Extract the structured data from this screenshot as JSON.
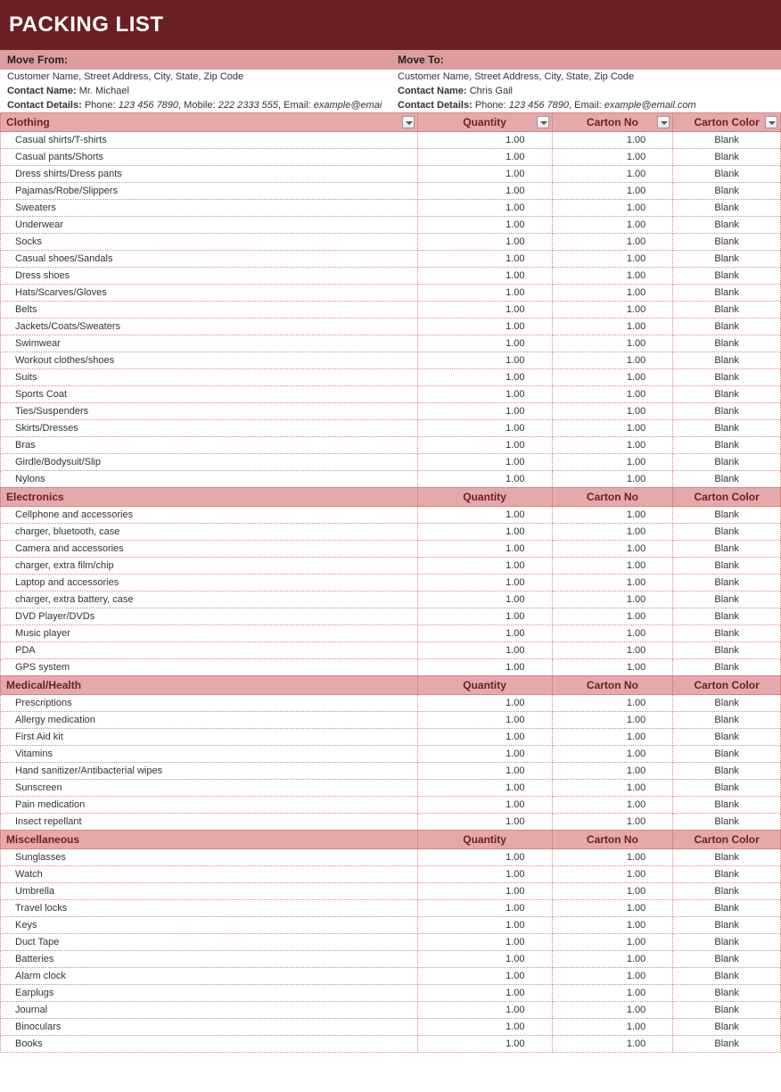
{
  "title": "PACKING LIST",
  "moveFrom": {
    "label": "Move From:",
    "address": "Customer Name, Street Address, City, State, Zip Code",
    "contactNameLabel": "Contact Name:",
    "contactName": "Mr. Michael",
    "contactDetailsLabel": "Contact Details:",
    "phoneLabel": "Phone:",
    "phone": "123 456 7890",
    "mobileLabel": "Mobile:",
    "mobile": "222 2333 555",
    "emailLabel": "Email:",
    "email": "example@emai"
  },
  "moveTo": {
    "label": "Move To:",
    "address": "Customer Name, Street Address, City, State, Zip Code",
    "contactNameLabel": "Contact Name:",
    "contactName": "Chris Gail",
    "contactDetailsLabel": "Contact Details:",
    "phoneLabel": "Phone:",
    "phone": "123 456 7890",
    "emailLabel": "Email:",
    "email": "example@email.com"
  },
  "columns": {
    "qty": "Quantity",
    "carton": "Carton No",
    "color": "Carton Color"
  },
  "sections": [
    {
      "name": "Clothing",
      "showFilters": true,
      "items": [
        {
          "name": "Casual shirts/T-shirts",
          "qty": "1.00",
          "carton": "1.00",
          "color": "Blank"
        },
        {
          "name": "Casual pants/Shorts",
          "qty": "1.00",
          "carton": "1.00",
          "color": "Blank"
        },
        {
          "name": "Dress shirts/Dress pants",
          "qty": "1.00",
          "carton": "1.00",
          "color": "Blank"
        },
        {
          "name": "Pajamas/Robe/Slippers",
          "qty": "1.00",
          "carton": "1.00",
          "color": "Blank"
        },
        {
          "name": "Sweaters",
          "qty": "1.00",
          "carton": "1.00",
          "color": "Blank"
        },
        {
          "name": "Underwear",
          "qty": "1.00",
          "carton": "1.00",
          "color": "Blank"
        },
        {
          "name": "Socks",
          "qty": "1.00",
          "carton": "1.00",
          "color": "Blank"
        },
        {
          "name": "Casual shoes/Sandals",
          "qty": "1.00",
          "carton": "1.00",
          "color": "Blank"
        },
        {
          "name": "Dress shoes",
          "qty": "1.00",
          "carton": "1.00",
          "color": "Blank"
        },
        {
          "name": "Hats/Scarves/Gloves",
          "qty": "1.00",
          "carton": "1.00",
          "color": "Blank"
        },
        {
          "name": "Belts",
          "qty": "1.00",
          "carton": "1.00",
          "color": "Blank"
        },
        {
          "name": "Jackets/Coats/Sweaters",
          "qty": "1.00",
          "carton": "1.00",
          "color": "Blank"
        },
        {
          "name": "Swimwear",
          "qty": "1.00",
          "carton": "1.00",
          "color": "Blank"
        },
        {
          "name": "Workout clothes/shoes",
          "qty": "1.00",
          "carton": "1.00",
          "color": "Blank"
        },
        {
          "name": "Suits",
          "qty": "1.00",
          "carton": "1.00",
          "color": "Blank"
        },
        {
          "name": "Sports Coat",
          "qty": "1.00",
          "carton": "1.00",
          "color": "Blank"
        },
        {
          "name": "Ties/Suspenders",
          "qty": "1.00",
          "carton": "1.00",
          "color": "Blank"
        },
        {
          "name": "Skirts/Dresses",
          "qty": "1.00",
          "carton": "1.00",
          "color": "Blank"
        },
        {
          "name": "Bras",
          "qty": "1.00",
          "carton": "1.00",
          "color": "Blank"
        },
        {
          "name": "Girdle/Bodysuit/Slip",
          "qty": "1.00",
          "carton": "1.00",
          "color": "Blank"
        },
        {
          "name": "Nylons",
          "qty": "1.00",
          "carton": "1.00",
          "color": "Blank"
        }
      ]
    },
    {
      "name": "Electronics",
      "showFilters": false,
      "items": [
        {
          "name": "Cellphone and accessories",
          "qty": "1.00",
          "carton": "1.00",
          "color": "Blank"
        },
        {
          "name": "charger, bluetooth, case",
          "qty": "1.00",
          "carton": "1.00",
          "color": "Blank"
        },
        {
          "name": "Camera and accessories",
          "qty": "1.00",
          "carton": "1.00",
          "color": "Blank"
        },
        {
          "name": "charger, extra film/chip",
          "qty": "1.00",
          "carton": "1.00",
          "color": "Blank"
        },
        {
          "name": "Laptop and accessories",
          "qty": "1.00",
          "carton": "1.00",
          "color": "Blank"
        },
        {
          "name": "charger, extra battery, case",
          "qty": "1.00",
          "carton": "1.00",
          "color": "Blank"
        },
        {
          "name": "DVD Player/DVDs",
          "qty": "1.00",
          "carton": "1.00",
          "color": "Blank"
        },
        {
          "name": "Music player",
          "qty": "1.00",
          "carton": "1.00",
          "color": "Blank"
        },
        {
          "name": "PDA",
          "qty": "1.00",
          "carton": "1.00",
          "color": "Blank"
        },
        {
          "name": "GPS system",
          "qty": "1.00",
          "carton": "1.00",
          "color": "Blank"
        }
      ]
    },
    {
      "name": "Medical/Health",
      "showFilters": false,
      "items": [
        {
          "name": "Prescriptions",
          "qty": "1.00",
          "carton": "1.00",
          "color": "Blank"
        },
        {
          "name": "Allergy medication",
          "qty": "1.00",
          "carton": "1.00",
          "color": "Blank"
        },
        {
          "name": "First Aid kit",
          "qty": "1.00",
          "carton": "1.00",
          "color": "Blank"
        },
        {
          "name": "Vitamins",
          "qty": "1.00",
          "carton": "1.00",
          "color": "Blank"
        },
        {
          "name": "Hand sanitizer/Antibacterial wipes",
          "qty": "1.00",
          "carton": "1.00",
          "color": "Blank"
        },
        {
          "name": "Sunscreen",
          "qty": "1.00",
          "carton": "1.00",
          "color": "Blank"
        },
        {
          "name": "Pain medication",
          "qty": "1.00",
          "carton": "1.00",
          "color": "Blank"
        },
        {
          "name": "Insect repellant",
          "qty": "1.00",
          "carton": "1.00",
          "color": "Blank"
        }
      ]
    },
    {
      "name": "Miscellaneous",
      "showFilters": false,
      "items": [
        {
          "name": "Sunglasses",
          "qty": "1.00",
          "carton": "1.00",
          "color": "Blank"
        },
        {
          "name": "Watch",
          "qty": "1.00",
          "carton": "1.00",
          "color": "Blank"
        },
        {
          "name": "Umbrella",
          "qty": "1.00",
          "carton": "1.00",
          "color": "Blank"
        },
        {
          "name": "Travel locks",
          "qty": "1.00",
          "carton": "1.00",
          "color": "Blank"
        },
        {
          "name": "Keys",
          "qty": "1.00",
          "carton": "1.00",
          "color": "Blank"
        },
        {
          "name": "Duct Tape",
          "qty": "1.00",
          "carton": "1.00",
          "color": "Blank"
        },
        {
          "name": "Batteries",
          "qty": "1.00",
          "carton": "1.00",
          "color": "Blank"
        },
        {
          "name": "Alarm clock",
          "qty": "1.00",
          "carton": "1.00",
          "color": "Blank"
        },
        {
          "name": "Earplugs",
          "qty": "1.00",
          "carton": "1.00",
          "color": "Blank"
        },
        {
          "name": "Journal",
          "qty": "1.00",
          "carton": "1.00",
          "color": "Blank"
        },
        {
          "name": "Binoculars",
          "qty": "1.00",
          "carton": "1.00",
          "color": "Blank"
        },
        {
          "name": "Books",
          "qty": "1.00",
          "carton": "1.00",
          "color": "Blank"
        }
      ]
    }
  ]
}
